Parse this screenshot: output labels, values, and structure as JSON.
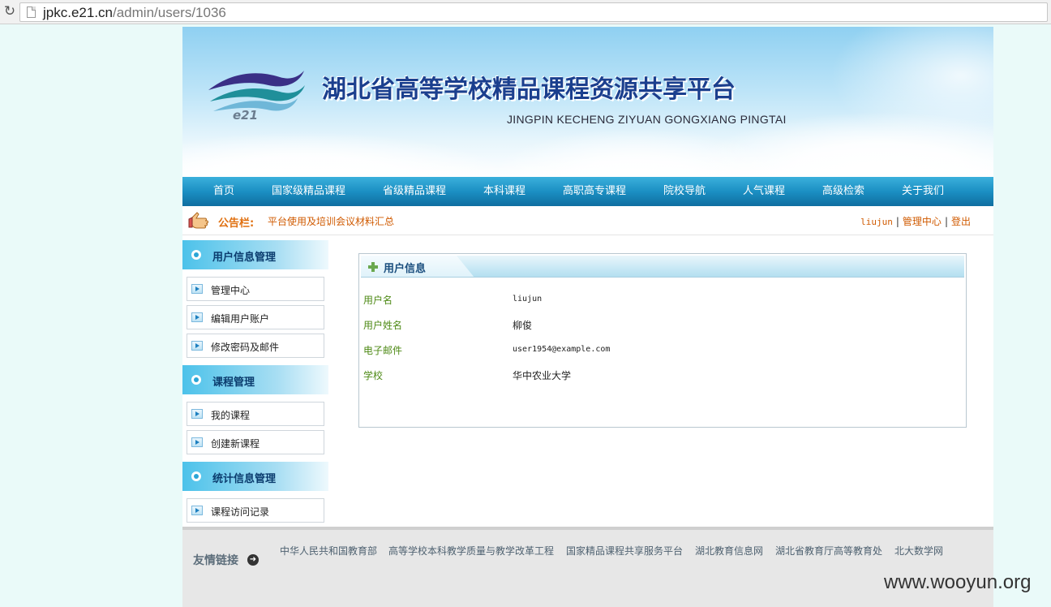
{
  "browser": {
    "url_host": "jpkc.e21.cn",
    "url_path": "/admin/users/1036"
  },
  "banner": {
    "logo_text": "e21",
    "title": "湖北省高等学校精品课程资源共享平台",
    "subtitle": "JINGPIN KECHENG ZIYUAN GONGXIANG PINGTAI"
  },
  "nav": {
    "items": [
      "首页",
      "国家级精品课程",
      "省级精品课程",
      "本科课程",
      "高职高专课程",
      "院校导航",
      "人气课程",
      "高级检索",
      "关于我们"
    ]
  },
  "notice": {
    "label": "公告栏:",
    "text": "平台使用及培训会议材料汇总"
  },
  "user_links": {
    "username": "liujun",
    "separator": "|",
    "admin_center": "管理中心",
    "logout": "登出"
  },
  "sidebar": {
    "sections": [
      {
        "title": "用户信息管理",
        "items": [
          "管理中心",
          "编辑用户账户",
          "修改密码及邮件"
        ]
      },
      {
        "title": "课程管理",
        "items": [
          "我的课程",
          "创建新课程"
        ]
      },
      {
        "title": "统计信息管理",
        "items": [
          "课程访问记录"
        ]
      }
    ]
  },
  "user_info": {
    "title": "用户信息",
    "fields": [
      {
        "label": "用户名",
        "value": "liujun"
      },
      {
        "label": "用户姓名",
        "value": "柳俊"
      },
      {
        "label": "电子邮件",
        "value": "user1954@example.com"
      },
      {
        "label": "学校",
        "value": "华中农业大学"
      }
    ]
  },
  "footer": {
    "title": "友情链接",
    "links": [
      "中华人民共和国教育部",
      "高等学校本科教学质量与教学改革工程",
      "国家精品课程共享服务平台",
      "湖北教育信息网",
      "湖北省教育厅高等教育处",
      "北大数学网"
    ]
  },
  "watermark": "www.wooyun.org",
  "colors": {
    "nav_blue": "#1b8fc3",
    "notice_orange": "#e07010",
    "label_green": "#4e8a16",
    "title_blue": "#1b3f8e"
  }
}
